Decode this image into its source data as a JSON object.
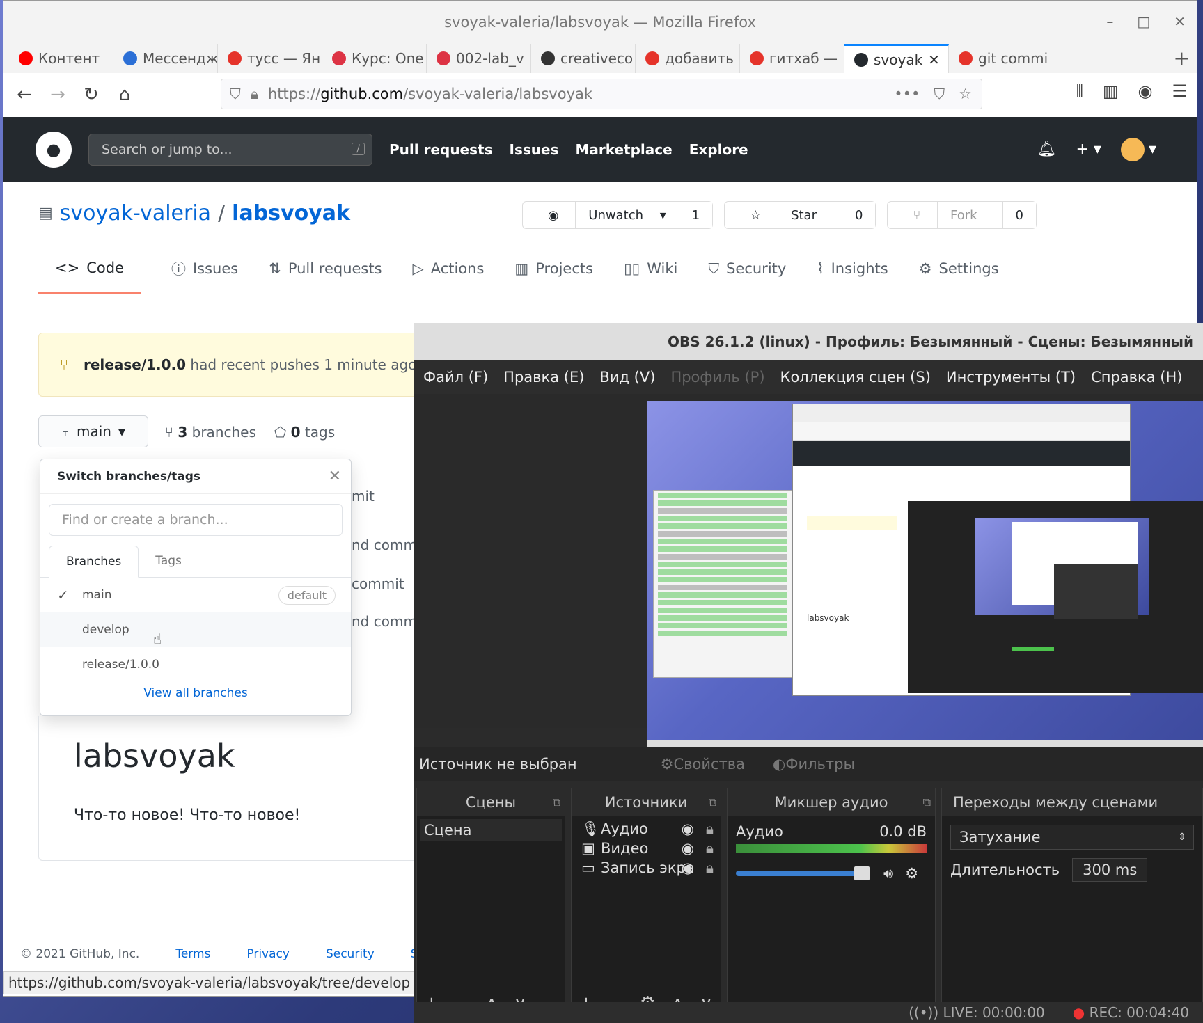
{
  "window_title": "svoyak-valeria/labsvoyak — Mozilla Firefox",
  "tabs": [
    {
      "label": "Контент",
      "icon": "youtube-icon",
      "color": "#ff0000"
    },
    {
      "label": "Мессендж",
      "icon": "messenger-icon",
      "color": "#2b6fd6"
    },
    {
      "label": "тусс — Ян",
      "icon": "yandex-icon",
      "color": "#e5332a"
    },
    {
      "label": "Курс: One",
      "icon": "course-icon",
      "color": "#d34"
    },
    {
      "label": "002-lab_v",
      "icon": "course-icon",
      "color": "#d34"
    },
    {
      "label": "creativeco",
      "icon": "cc-icon",
      "color": "#333"
    },
    {
      "label": "добавить",
      "icon": "yandex-icon",
      "color": "#e5332a"
    },
    {
      "label": "гитхаб —",
      "icon": "yandex-icon",
      "color": "#e5332a"
    },
    {
      "label": "svoyak",
      "icon": "github-icon",
      "color": "#24292e",
      "active": true
    },
    {
      "label": "git commi",
      "icon": "yandex-icon",
      "color": "#e5332a"
    }
  ],
  "url": {
    "prefix": "https://",
    "host": "github.com",
    "path": "/svoyak-valeria/labsvoyak"
  },
  "github": {
    "search_placeholder": "Search or jump to...",
    "search_key": "/",
    "nav": [
      "Pull requests",
      "Issues",
      "Marketplace",
      "Explore"
    ],
    "owner": "svoyak-valeria",
    "sep": "/",
    "repo": "labsvoyak",
    "unwatch": "Unwatch",
    "watch_count": "1",
    "star": "Star",
    "star_count": "0",
    "fork": "Fork",
    "fork_count": "0",
    "repo_tabs": [
      "Code",
      "Issues",
      "Pull requests",
      "Actions",
      "Projects",
      "Wiki",
      "Security",
      "Insights",
      "Settings"
    ],
    "banner_branch": "release/1.0.0",
    "banner_text": "had recent pushes 1 minute ago",
    "branch": "main",
    "branches_count": "3",
    "branches_label": "branches",
    "tags_count": "0",
    "tags_label": "tags",
    "dropdown": {
      "title": "Switch branches/tags",
      "placeholder": "Find or create a branch...",
      "tab_branches": "Branches",
      "tab_tags": "Tags",
      "items": [
        "main",
        "develop",
        "release/1.0.0"
      ],
      "default_badge": "default",
      "view_all": "View all branches"
    },
    "bg_commits": [
      "mit",
      "nd commi",
      "commit",
      "nd commi"
    ],
    "readme_title": "labsvoyak",
    "readme_text": "Что-то новое! Что-то новое!",
    "footer": [
      "© 2021 GitHub, Inc.",
      "Terms",
      "Privacy",
      "Security",
      "St"
    ],
    "status_url": "https://github.com/svoyak-valeria/labsvoyak/tree/develop"
  },
  "obs": {
    "title": "OBS 26.1.2 (linux) - Профиль: Безымянный - Сцены: Безымянный",
    "menu": [
      {
        "label": "Файл (F)"
      },
      {
        "label": "Правка (E)"
      },
      {
        "label": "Вид (V)"
      },
      {
        "label": "Профиль (P)",
        "disabled": true
      },
      {
        "label": "Коллекция сцен (S)"
      },
      {
        "label": "Инструменты (T)"
      },
      {
        "label": "Справка (H)"
      }
    ],
    "no_source": "Источник не выбран",
    "properties": "Свойства",
    "filters": "Фильтры",
    "scenes_title": "Сцены",
    "scene": "Сцена",
    "sources_title": "Источники",
    "sources": [
      {
        "label": "Аудио",
        "icon": "microphone-icon"
      },
      {
        "label": "Видео",
        "icon": "camera-icon"
      },
      {
        "label": "Запись экра",
        "icon": "monitor-icon"
      }
    ],
    "mixer_title": "Микшер аудио",
    "mixer_channel": "Аудио",
    "mixer_db": "0.0 dB",
    "transitions_title": "Переходы между сценами",
    "transition": "Затухание",
    "duration_label": "Длительность",
    "duration": "300 ms",
    "live": "LIVE: 00:00:00",
    "rec": "REC: 00:04:40"
  }
}
